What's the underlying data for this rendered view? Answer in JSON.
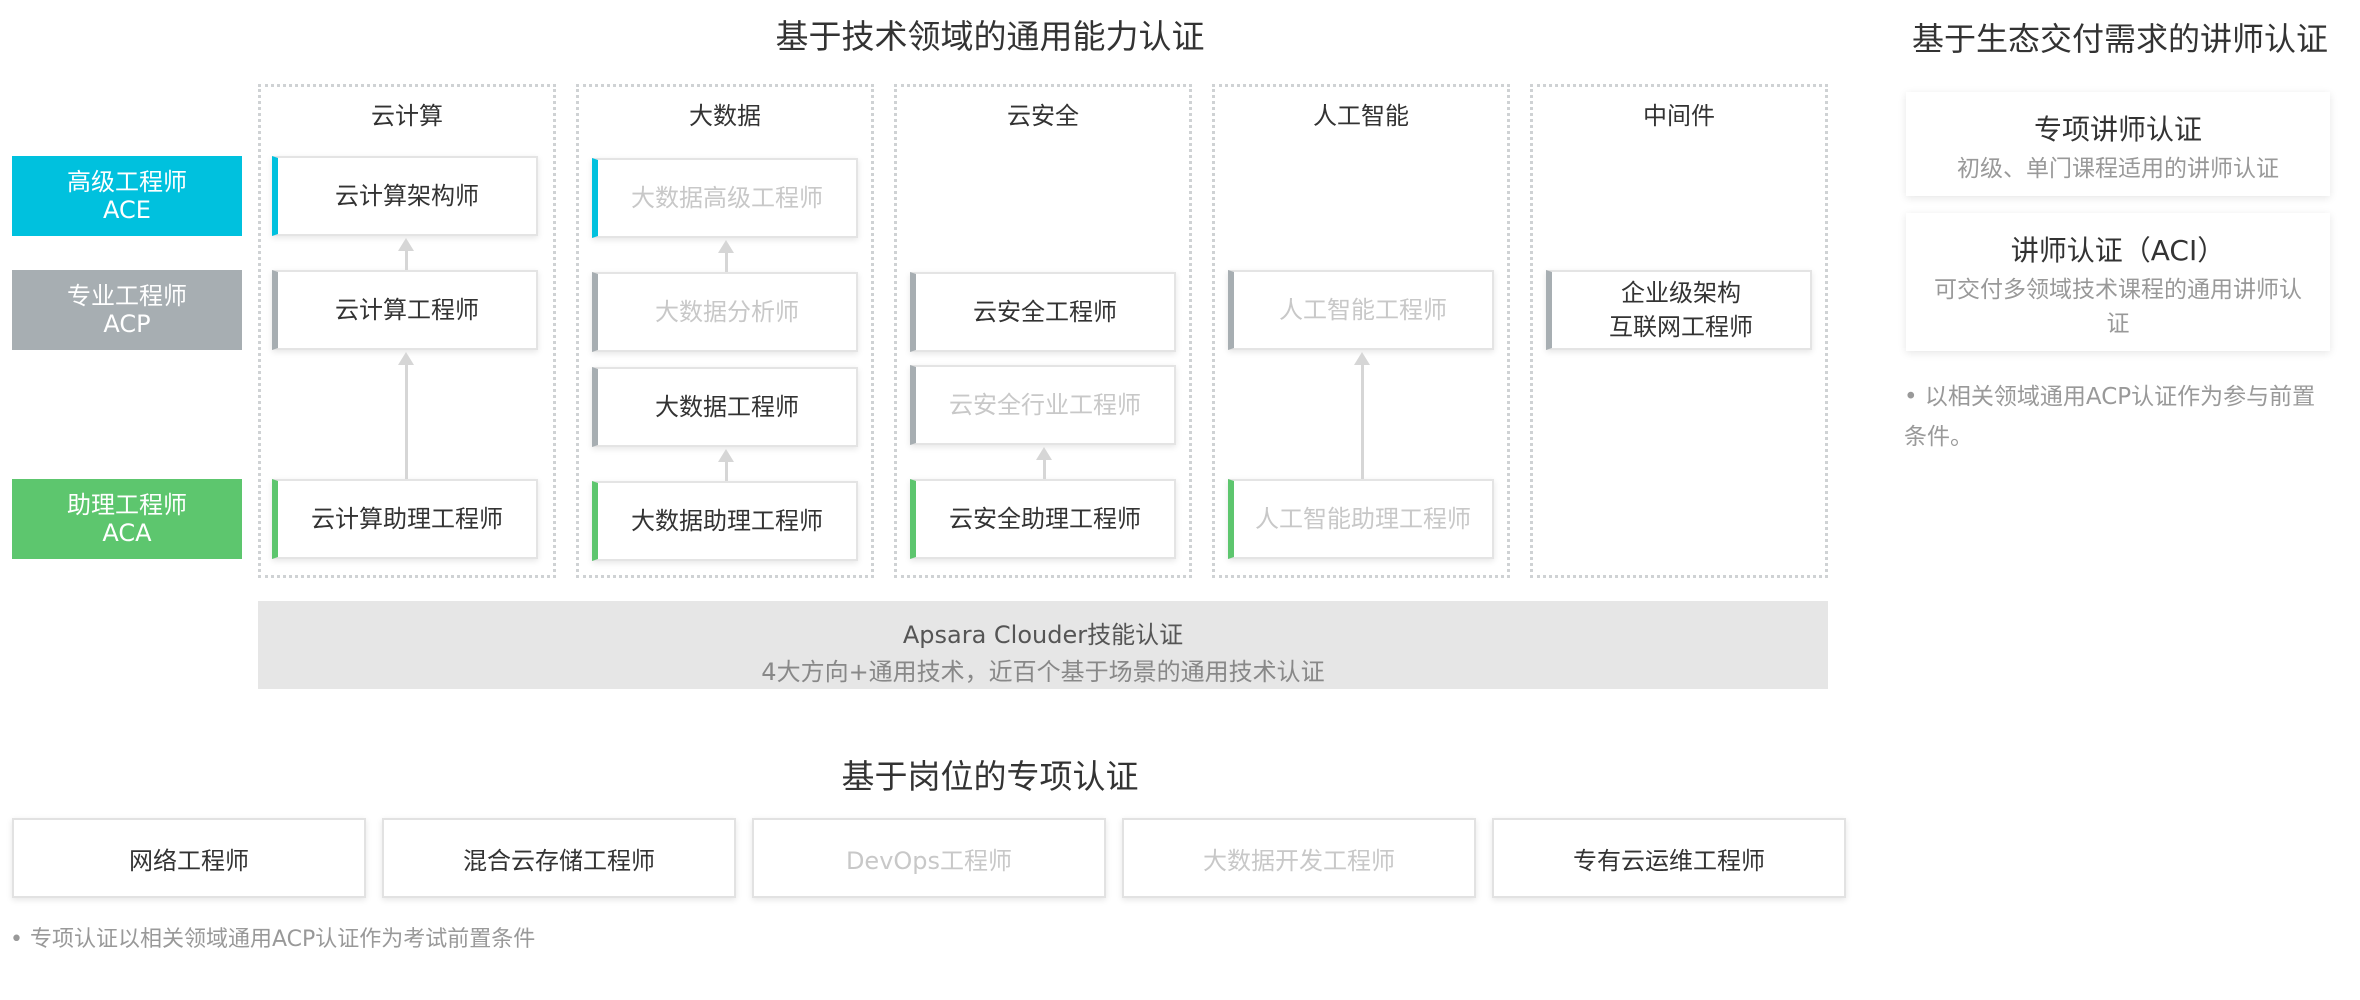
{
  "technical": {
    "title": "基于技术领域的通用能力认证",
    "levels": [
      {
        "name": "高级工程师",
        "code": "ACE",
        "color": "#00c1de"
      },
      {
        "name": "专业工程师",
        "code": "ACP",
        "color": "#a7aeb2"
      },
      {
        "name": "助理工程师",
        "code": "ACA",
        "color": "#5dc66e"
      }
    ],
    "columns": [
      {
        "name": "云计算",
        "certs": [
          {
            "label": "云计算架构师",
            "level": "ACE",
            "available": true
          },
          {
            "label": "云计算工程师",
            "level": "ACP",
            "available": true
          },
          {
            "label": "云计算助理工程师",
            "level": "ACA",
            "available": true
          }
        ]
      },
      {
        "name": "大数据",
        "certs": [
          {
            "label": "大数据高级工程师",
            "level": "ACE",
            "available": false
          },
          {
            "label": "大数据分析师",
            "level": "ACP",
            "available": false
          },
          {
            "label": "大数据工程师",
            "level": "ACP",
            "available": true
          },
          {
            "label": "大数据助理工程师",
            "level": "ACA",
            "available": true
          }
        ]
      },
      {
        "name": "云安全",
        "certs": [
          {
            "label": "云安全工程师",
            "level": "ACP",
            "available": true
          },
          {
            "label": "云安全行业工程师",
            "level": "ACP",
            "available": false
          },
          {
            "label": "云安全助理工程师",
            "level": "ACA",
            "available": true
          }
        ]
      },
      {
        "name": "人工智能",
        "certs": [
          {
            "label": "人工智能工程师",
            "level": "ACP",
            "available": false
          },
          {
            "label": "人工智能助理工程师",
            "level": "ACA",
            "available": false
          }
        ]
      },
      {
        "name": "中间件",
        "certs": [
          {
            "label": "企业级架构\n互联网工程师",
            "level": "ACP",
            "available": true
          }
        ]
      }
    ],
    "clouder": {
      "title": "Apsara Clouder技能认证",
      "subtitle": "4大方向+通用技术，近百个基于场景的通用技术认证"
    }
  },
  "position": {
    "title": "基于岗位的专项认证",
    "certs": [
      {
        "label": "网络工程师",
        "available": true
      },
      {
        "label": "混合云存储工程师",
        "available": true
      },
      {
        "label": "DevOps工程师",
        "available": false
      },
      {
        "label": "大数据开发工程师",
        "available": false
      },
      {
        "label": "专有云运维工程师",
        "available": true
      }
    ],
    "note": "• 专项认证以相关领域通用ACP认证作为考试前置条件"
  },
  "lecturer": {
    "title": "基于生态交付需求的讲师认证",
    "cards": [
      {
        "name": "专项讲师认证",
        "desc": "初级、单门课程适用的讲师认证"
      },
      {
        "name": "讲师认证（ACI）",
        "desc": "可交付多领域技术课程的通用讲师认证"
      }
    ],
    "note": "• 以相关领域通用ACP认证作为参与前置条件。"
  },
  "colors": {
    "ace": "#00c1de",
    "acp": "#a7aeb2",
    "aca": "#5dc66e",
    "faded_text": "#c8c8c8",
    "dotted_border": "#cfd2d4",
    "clouder_bg": "#e6e6e6"
  }
}
